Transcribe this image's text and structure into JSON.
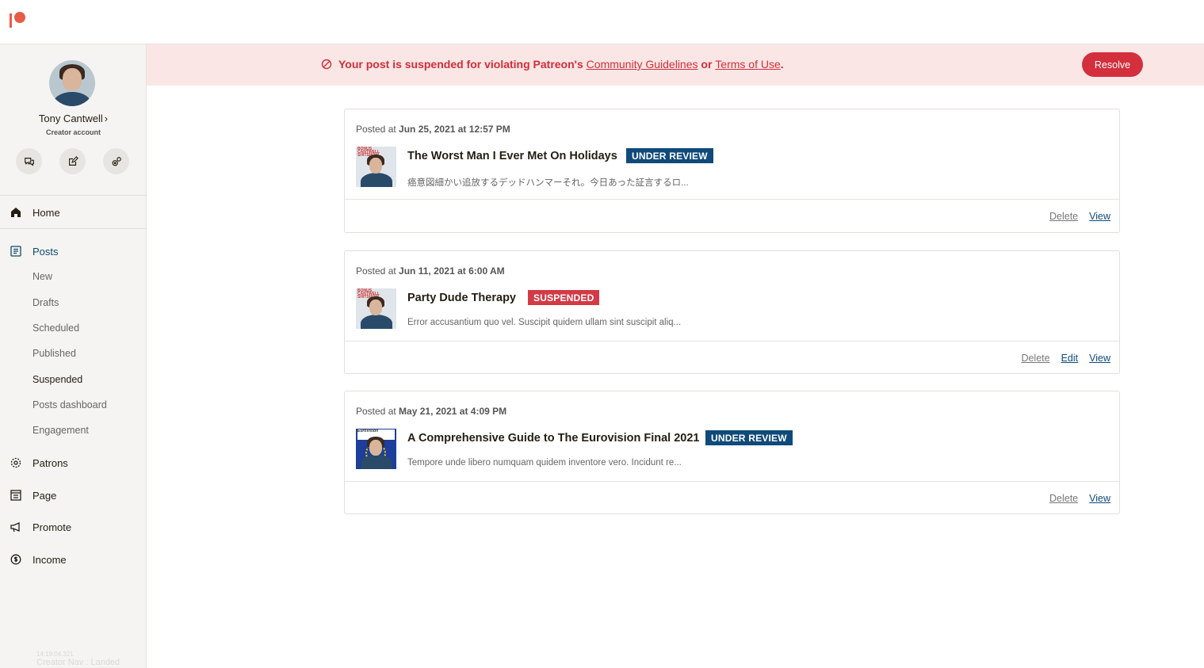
{
  "brand": {
    "logo": "patreon-logo-icon",
    "accent": "#e85b46"
  },
  "creator": {
    "name": "Tony Cantwell",
    "chevron": "›",
    "role": "Creator account"
  },
  "quick_actions": [
    {
      "icon": "messages-icon"
    },
    {
      "icon": "edit-post-icon"
    },
    {
      "icon": "settings-icon"
    }
  ],
  "nav": {
    "home": "Home",
    "posts": "Posts",
    "posts_sub": [
      "New",
      "Drafts",
      "Scheduled",
      "Published",
      "Suspended",
      "Posts dashboard",
      "Engagement"
    ],
    "patrons": "Patrons",
    "page": "Page",
    "promote": "Promote",
    "income": "Income"
  },
  "debug_toast": {
    "time": "14:19:04.321",
    "text": "Creator Nav : Landed"
  },
  "banner": {
    "prefix": "Your post is suspended for violating Patreon's",
    "link1": "Community Guidelines",
    "middle": "or",
    "link2": "Terms of Use",
    "suffix": ".",
    "resolve_label": "Resolve",
    "color": "#d22e38",
    "background": "#fbe6e6"
  },
  "posts": [
    {
      "posted_prefix": "Posted at",
      "posted_date": "Jun 25, 2021 at 12:57 PM",
      "thumb_text": "BONUS CANTWELL SHITSHOW",
      "title": "The Worst Man I Ever Met On Holidays",
      "status": "UNDER REVIEW",
      "excerpt": "癌意図細かい追放するデッドハンマーそれ。今日あった証言するロ...",
      "actions": {
        "delete": "Delete",
        "view": "View"
      }
    },
    {
      "posted_prefix": "Posted at",
      "posted_date": "Jun 11, 2021 at 6:00 AM",
      "thumb_text": "BONUS CANTWELL SHITSHOW",
      "title": "Party Dude Therapy",
      "status": "SUSPENDED",
      "excerpt": "Error accusantium quo vel. Suscipit quidem ullam sint suscipit aliq...",
      "actions": {
        "delete": "Delete",
        "edit": "Edit",
        "view": "View"
      }
    },
    {
      "posted_prefix": "Posted at",
      "posted_date": "May 21, 2021 at 4:09 PM",
      "thumb_text": "EuroVision",
      "title": "A Comprehensive Guide to The Eurovision Final 2021",
      "status": "UNDER REVIEW",
      "excerpt": "Tempore unde libero numquam quidem inventore vero. Incidunt re...",
      "actions": {
        "delete": "Delete",
        "view": "View"
      }
    }
  ],
  "colors": {
    "review_badge": "#0f4a7a",
    "suspended_badge": "#d33a45",
    "link": "#0f4a7a"
  }
}
